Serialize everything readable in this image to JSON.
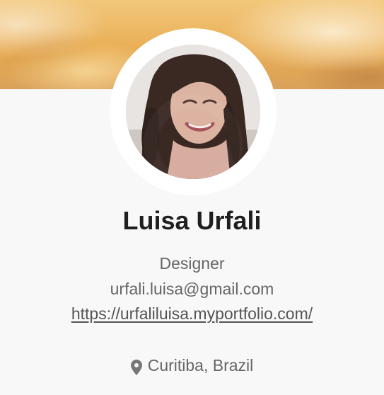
{
  "profile": {
    "name": "Luisa Urfali",
    "role": "Designer",
    "email": "urfali.luisa@gmail.com",
    "website": "https://urfaliluisa.myportfolio.com/",
    "location": "Curitiba, Brazil"
  },
  "icons": {
    "location": "location-pin-icon"
  },
  "colors": {
    "page_background": "#f8f8f8",
    "name_text": "#1f1f1f",
    "secondary_text": "#666666",
    "cover_primary": "#e9ae55"
  }
}
